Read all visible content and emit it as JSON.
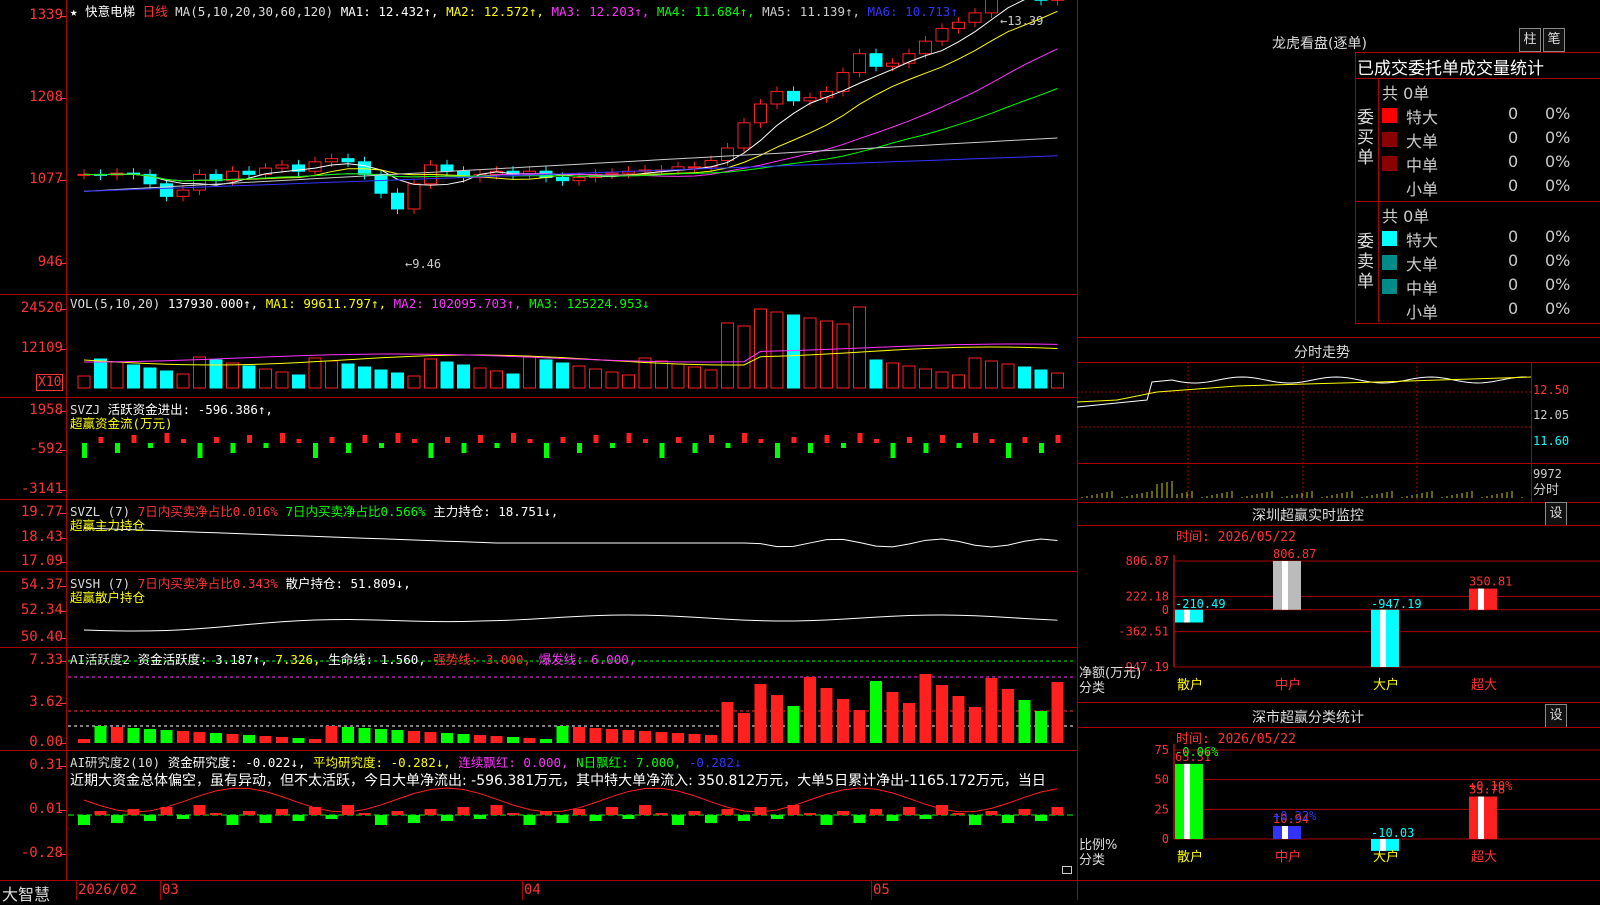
{
  "stock": {
    "name": "快意电梯",
    "period": "日线",
    "star": "★"
  },
  "kline": {
    "ma_params": "MA(5,10,20,30,60,120)",
    "ma": [
      {
        "label": "MA1: 12.432↑,",
        "color": "#ffffff"
      },
      {
        "label": "MA2: 12.572↑,",
        "color": "#ffff00"
      },
      {
        "label": "MA3: 12.203↑,",
        "color": "#ff33ff"
      },
      {
        "label": "MA4: 11.684↑,",
        "color": "#00ff00"
      },
      {
        "label": "MA5: 11.139↑,",
        "color": "#cccccc"
      },
      {
        "label": "MA6: 10.713↑",
        "color": "#3333ff"
      }
    ],
    "y_ticks": [
      "1339",
      "1208",
      "1077",
      "946"
    ],
    "max_label": "13.39",
    "min_label": "9.46"
  },
  "vol": {
    "title": "VOL(5,10,20)",
    "value": "137930.000↑,",
    "ma1": "MA1: 99611.797↑,",
    "ma2": "MA2: 102095.703↑,",
    "ma3": "MA3: 125224.953↓",
    "y_ticks": [
      "24520",
      "12109"
    ],
    "unit": "X10"
  },
  "svzj": {
    "title": "SVZJ",
    "desc": "活跃资金进出: -596.386↑,",
    "sub": "超赢资金流(万元)",
    "y_ticks": [
      "1958",
      "-592",
      "-3141"
    ]
  },
  "svzl": {
    "title": "SVZL (7)",
    "t1": "7日内买卖净占比0.016%",
    "t2": "7日内买卖净占比0.566%",
    "t3": "主力持仓: 18.751↓,",
    "sub": "超赢主力持仓",
    "y_ticks": [
      "19.77",
      "18.43",
      "17.09"
    ]
  },
  "svsh": {
    "title": "SVSH (7)",
    "t1": "7日内买卖净占比0.343%",
    "t2": "散户持仓: 51.809↓,",
    "sub": "超赢散户持仓",
    "y_ticks": [
      "54.37",
      "52.34",
      "50.40"
    ]
  },
  "ai1": {
    "title": "AI活跃度2",
    "t1": "资金活跃度: 3.187↑,",
    "t2": "7.326,",
    "t3": "生命线: 1.560,",
    "t4": "强势线: 3.000,",
    "t5": "爆发线: 6.000,",
    "y_ticks": [
      "7.33",
      "3.62",
      "0.00"
    ]
  },
  "ai2": {
    "title": "AI研究度2(10)",
    "t1": "资金研究度: -0.022↓,",
    "t2": "平均研究度: -0.282↓,",
    "t3": "连续飘红: 0.000,",
    "t4": "N日飘红: 7.000,",
    "t5": "-0.282↓",
    "news": "近期大资金总体偏空，虽有异动，但不太活跃，今日大单净流出: -596.381万元，其中特大单净流入: 350.812万元，大单5日累计净出-1165.172万元，当日",
    "y_ticks": [
      "0.31",
      "0.01",
      "-0.28"
    ]
  },
  "footer": {
    "brand": "大智慧",
    "dates": [
      "2026/02",
      "03",
      "04",
      "05"
    ]
  },
  "dragon": {
    "title": "龙虎看盘(逐单)",
    "btn1": "柱",
    "btn2": "笔",
    "tabs": "已成交委托单成交量统计",
    "buy_label": "委买单",
    "sell_label": "委卖单",
    "buy_total": "共 0单",
    "sell_total": "共 0单",
    "rows": [
      {
        "name": "特大",
        "v": "0",
        "p": "0%"
      },
      {
        "name": "大单",
        "v": "0",
        "p": "0%"
      },
      {
        "name": "中单",
        "v": "0",
        "p": "0%"
      },
      {
        "name": "小单",
        "v": "0",
        "p": "0%"
      }
    ],
    "buy_colors": [
      "#ff0000",
      "#8b0000",
      "#8b0000",
      "#000000"
    ],
    "sell_colors": [
      "#00ffff",
      "#008b8b",
      "#008b8b",
      "#000000"
    ]
  },
  "fenshi": {
    "title": "分时走势",
    "y_ticks": [
      "12.50",
      "12.05",
      "11.60",
      "9972"
    ],
    "unit": "分时"
  },
  "monitor": {
    "title": "深圳超赢实时监控",
    "btn": "设",
    "time": "时间: 2026/05/22",
    "y_ticks": [
      "806.87",
      "222.18",
      "0",
      "-362.51",
      "-947.19"
    ],
    "categories": [
      "散户",
      "中户",
      "大户",
      "超大"
    ],
    "values": [
      -210.49,
      806.87,
      -947.19,
      350.81
    ],
    "labels": [
      "-210.49",
      "806.87",
      "-947.19",
      "350.81"
    ],
    "ylabel": "净额(万元)",
    "xlabel": "分类"
  },
  "classify": {
    "title": "深市超赢分类统计",
    "btn": "设",
    "time": "时间: 2026/05/22",
    "y_ticks": [
      "75",
      "50",
      "25",
      "0"
    ],
    "categories": [
      "散户",
      "中户",
      "大户",
      "超大"
    ],
    "values": [
      63.31,
      10.94,
      -10.03,
      35.78
    ],
    "labels": [
      "63.31",
      "10.94",
      "-10.03",
      "35.78"
    ],
    "changes": [
      "-0.06%",
      "+0.22%",
      "+0.10%"
    ],
    "ylabel": "比例%",
    "xlabel": "分类"
  },
  "colors": {
    "up": "#ff2020",
    "down": "#00ffff",
    "grid": "#aa0000",
    "axis": "#ff3333"
  }
}
